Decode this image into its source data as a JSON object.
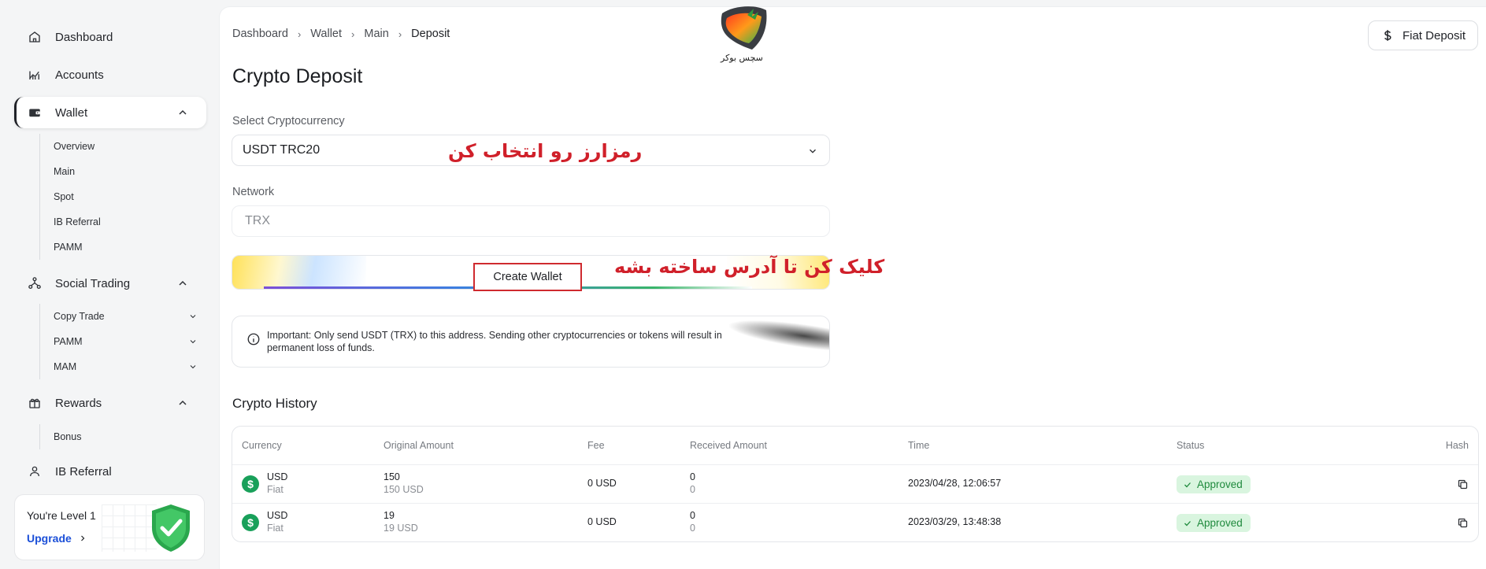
{
  "sidebar": {
    "dashboard": "Dashboard",
    "accounts": "Accounts",
    "wallet": "Wallet",
    "wallet_items": [
      "Overview",
      "Main",
      "Spot",
      "IB Referral",
      "PAMM"
    ],
    "social_trading": "Social Trading",
    "social_items": [
      "Copy Trade",
      "PAMM",
      "MAM"
    ],
    "rewards": "Rewards",
    "rewards_items": [
      "Bonus"
    ],
    "ib_referral": "IB Referral",
    "level": {
      "title": "You're Level 1",
      "upgrade": "Upgrade"
    }
  },
  "breadcrumb": [
    "Dashboard",
    "Wallet",
    "Main",
    "Deposit"
  ],
  "logo_text": "سچس بوکر",
  "fiat_deposit": "Fiat Deposit",
  "page_title": "Crypto Deposit",
  "form": {
    "crypto_label": "Select Cryptocurrency",
    "crypto_value": "USDT TRC20",
    "network_label": "Network",
    "network_value": "TRX",
    "create_wallet": "Create Wallet"
  },
  "annotations": {
    "select": "رمزارز رو انتخاب کن",
    "create": "کلیک کن تا آدرس ساخته بشه"
  },
  "notice": "Important: Only send USDT (TRX) to this address. Sending other cryptocurrencies or tokens will result in permanent loss of funds.",
  "history": {
    "title": "Crypto History",
    "columns": [
      "Currency",
      "Original Amount",
      "Fee",
      "Received Amount",
      "Time",
      "Status",
      "Hash"
    ],
    "rows": [
      {
        "currency": "USD",
        "currency_type": "Fiat",
        "original": "150",
        "original_sub": "150 USD",
        "fee": "0 USD",
        "received": "0",
        "received_sub": "0",
        "time": "2023/04/28, 12:06:57",
        "status": "Approved"
      },
      {
        "currency": "USD",
        "currency_type": "Fiat",
        "original": "19",
        "original_sub": "19 USD",
        "fee": "0 USD",
        "received": "0",
        "received_sub": "0",
        "time": "2023/03/29, 13:48:38",
        "status": "Approved"
      }
    ]
  },
  "colors": {
    "accent_blue": "#1b4fd8",
    "annotation_red": "#d0202a",
    "approved_bg": "#d9f5df",
    "approved_text": "#1f8a3d"
  }
}
